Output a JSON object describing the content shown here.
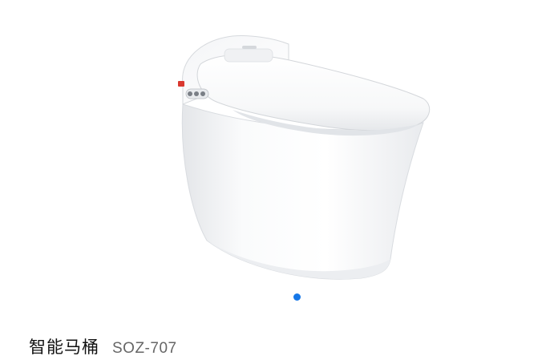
{
  "product": {
    "name": "智能马桶",
    "model": "SOZ-707"
  },
  "carousel": {
    "slide_count": 1,
    "active_index": 0
  },
  "colors": {
    "dot_active": "#1677e8",
    "name_text": "#111111",
    "model_text": "#666666"
  }
}
